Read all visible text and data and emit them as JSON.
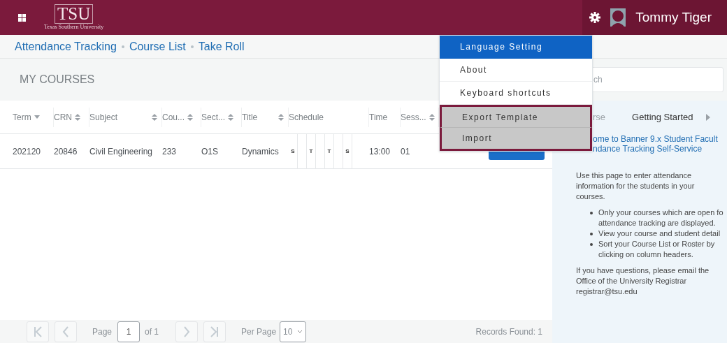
{
  "header": {
    "logo": "TSU",
    "logo_subtitle": "Texas Southern University",
    "user_name": "Tommy Tiger"
  },
  "breadcrumb": [
    "Attendance Tracking",
    "Course List",
    "Take Roll"
  ],
  "page_title": "MY COURSES",
  "search": {
    "placeholder": "ch"
  },
  "table": {
    "columns": [
      {
        "label": "Term",
        "kind": "sorted"
      },
      {
        "label": "CRN",
        "kind": "sortable"
      },
      {
        "label": "Subject",
        "kind": "sortable"
      },
      {
        "label": "Cou...",
        "kind": "sortable"
      },
      {
        "label": "Sect...",
        "kind": "sortable"
      },
      {
        "label": "Title",
        "kind": "sortable"
      },
      {
        "label": "Schedule",
        "kind": "plain"
      },
      {
        "label": "Time",
        "kind": "plain"
      },
      {
        "label": "Sess...",
        "kind": "sortable"
      }
    ],
    "rows": [
      {
        "term": "202120",
        "crn": "20846",
        "subject": "Civil Engineering",
        "course": "233",
        "section": "O1S",
        "title": "Dynamics",
        "schedule": [
          {
            "kind": "day",
            "label": "S"
          },
          {
            "kind": "blank"
          },
          {
            "kind": "day",
            "label": "T"
          },
          {
            "kind": "blank"
          },
          {
            "kind": "day",
            "label": "T"
          },
          {
            "kind": "blank"
          },
          {
            "kind": "day",
            "label": "S"
          }
        ],
        "time": "13:00",
        "session": "01"
      }
    ]
  },
  "pagination": {
    "page_label": "Page",
    "page": "1",
    "of": "of 1",
    "per_page_label": "Per Page",
    "per_page": "10",
    "records": "Records Found: 1"
  },
  "menu": [
    {
      "label": "Language Setting",
      "selected": true,
      "highlighted": false
    },
    {
      "label": "About",
      "selected": false,
      "highlighted": false
    },
    {
      "label": "Keyboard shortcuts",
      "selected": false,
      "highlighted": false
    },
    {
      "label": "Export Template",
      "selected": false,
      "highlighted": true
    },
    {
      "label": "Import",
      "selected": false,
      "highlighted": true
    }
  ],
  "panel": {
    "tabs": [
      {
        "label": "rse",
        "selected": false
      },
      {
        "label": "Getting Started",
        "selected": true
      }
    ],
    "heading_lines": [
      "ome to Banner 9.x Student Facult",
      "ndance Tracking Self-Service"
    ],
    "intro": "Use this page to enter attendance information for the students in your courses.",
    "bullets": [
      {
        "lines": [
          "Only your courses which are open fo",
          "attendance tracking are displayed."
        ]
      },
      {
        "lines": [
          "View your course and student detail"
        ]
      },
      {
        "lines": [
          "Sort your Course List or Roster by",
          "clicking on column headers."
        ]
      }
    ],
    "contact": "If you have questions, please email the Office of the University Registrar",
    "email": "registrar@tsu.edu"
  }
}
